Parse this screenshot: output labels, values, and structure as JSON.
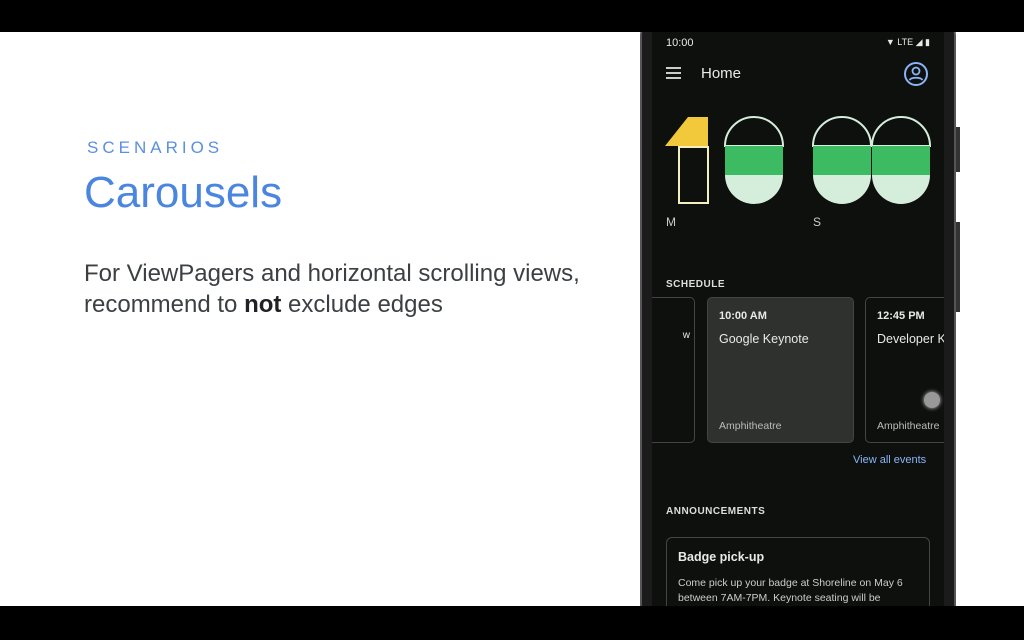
{
  "slide": {
    "eyebrow": "SCENARIOS",
    "title": "Carousels",
    "body_pre": "For ViewPagers and horizontal scrolling views, recommend to ",
    "body_bold": "not",
    "body_post": " exclude edges"
  },
  "phone": {
    "status": {
      "time": "10:00",
      "network": "LTE"
    },
    "appbar": {
      "title": "Home",
      "menu_icon": "hamburger-menu-icon",
      "account_icon": "account-circle-icon"
    },
    "countdown": {
      "labels": [
        "M",
        "S"
      ],
      "colors": {
        "yellow": "#f2c93b",
        "green": "#3dbb63",
        "light_green": "#d4eedb"
      }
    },
    "schedule": {
      "heading": "SCHEDULE",
      "cards": [
        {
          "time": "",
          "name": "w",
          "place": ""
        },
        {
          "time": "10:00 AM",
          "name": "Google Keynote",
          "place": "Amphitheatre"
        },
        {
          "time": "12:45 PM",
          "name": "Developer K",
          "place": "Amphitheatre"
        }
      ],
      "view_all": "View all events"
    },
    "announcements": {
      "heading": "ANNOUNCEMENTS",
      "title": "Badge pick-up",
      "text": "Come pick up your badge at Shoreline on May 6 between 7AM-7PM. Keynote seating will be"
    }
  }
}
